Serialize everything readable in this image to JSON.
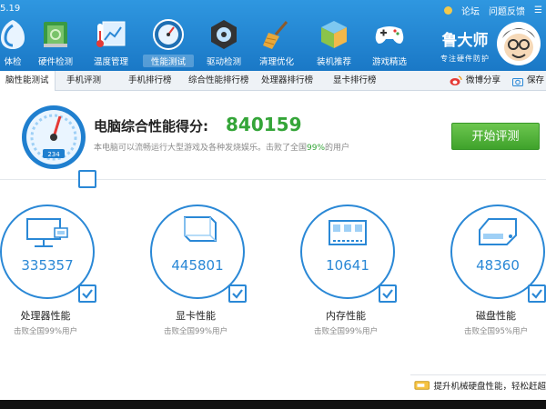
{
  "app": {
    "version": "5.19"
  },
  "nav": [
    {
      "label": "体检",
      "icon": "health-check-icon"
    },
    {
      "label": "硬件检测",
      "icon": "hardware-board-icon"
    },
    {
      "label": "温度管理",
      "icon": "thermometer-icon"
    },
    {
      "label": "性能测试",
      "icon": "speed-gauge-icon",
      "active": true
    },
    {
      "label": "驱动检测",
      "icon": "driver-gear-icon"
    },
    {
      "label": "清理优化",
      "icon": "broom-icon"
    },
    {
      "label": "装机推荐",
      "icon": "cube-icon"
    },
    {
      "label": "游戏精选",
      "icon": "gamepad-icon"
    }
  ],
  "top_links": {
    "forum": "论坛",
    "feedback": "问题反馈"
  },
  "brand": {
    "name": "鲁大师",
    "slogan": "专注硬件防护"
  },
  "tabs": [
    {
      "label": "脑性能测试",
      "active": true
    },
    {
      "label": "手机评测"
    },
    {
      "label": "手机排行榜"
    },
    {
      "label": "综合性能排行榜"
    },
    {
      "label": "处理器排行榜"
    },
    {
      "label": "显卡排行榜"
    }
  ],
  "tab_actions": {
    "share": "微博分享",
    "save": "保存"
  },
  "score": {
    "title": "电脑综合性能得分:",
    "value": "840159",
    "gauge_value": "234",
    "desc_prefix": "本电脑可以流畅运行大型游戏及各种发烧娱乐。击败了全国",
    "desc_percent": "99%",
    "desc_suffix": "的用户"
  },
  "start_button": "开始评测",
  "cards": [
    {
      "score": "335357",
      "title": "处理器性能",
      "beat": "击败全国99%用户",
      "icon": "processor-monitor-icon"
    },
    {
      "score": "445801",
      "title": "显卡性能",
      "beat": "击败全国99%用户",
      "icon": "graphics-cube-icon"
    },
    {
      "score": "10641",
      "title": "内存性能",
      "beat": "击败全国99%用户",
      "icon": "memory-chip-icon"
    },
    {
      "score": "48360",
      "title": "磁盘性能",
      "beat": "击败全国95%用户",
      "icon": "disk-drive-icon"
    }
  ],
  "tip": {
    "text": "提升机械硬盘性能，轻松赶超",
    "icon": "hard-disk-icon"
  },
  "colors": {
    "primary": "#1f86d6",
    "accent_green": "#34a538",
    "text": "#222222",
    "muted": "#8a8a8a"
  }
}
